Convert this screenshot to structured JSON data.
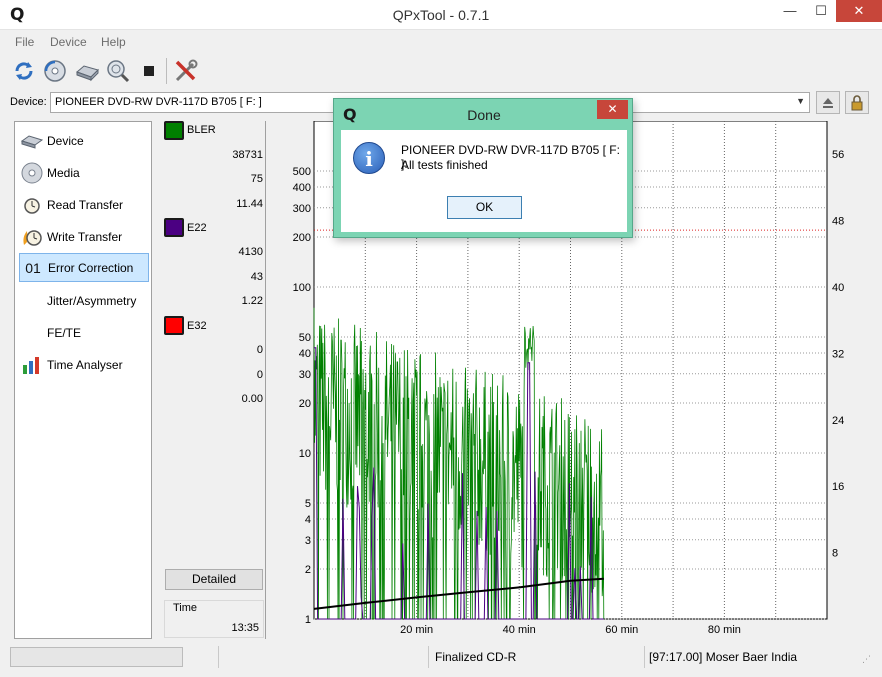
{
  "window": {
    "logo": "Q",
    "title": "QPxTool - 0.7.1",
    "minimize": "—",
    "maximize": "☐",
    "close": "✕"
  },
  "menu": [
    "File",
    "Device",
    "Help"
  ],
  "toolbar": {
    "icons": [
      "refresh-icon",
      "scan-media-icon",
      "drive-icon",
      "search-media-icon",
      "stop-icon",
      "tools-icon"
    ]
  },
  "device": {
    "label": "Device:",
    "selected": "PIONEER  DVD-RW  DVR-117D B705 [ F: ]"
  },
  "sidebar": {
    "items": [
      {
        "label": "Device",
        "icon": "device-icon"
      },
      {
        "label": "Media",
        "icon": "disc-icon"
      },
      {
        "label": "Read Transfer",
        "icon": "clock-icon"
      },
      {
        "label": "Write Transfer",
        "icon": "clock-flame-icon"
      },
      {
        "label": "Error Correction",
        "icon_text": "01",
        "active": true
      },
      {
        "label": "Jitter/Asymmetry"
      },
      {
        "label": "FE/TE"
      },
      {
        "label": "Time Analyser",
        "icon": "bar-chart-icon"
      }
    ]
  },
  "legend": {
    "bler": {
      "name": "BLER",
      "color": "#008000",
      "values": [
        "38731",
        "75",
        "11.44"
      ]
    },
    "e22": {
      "name": "E22",
      "color": "#4b0082",
      "values": [
        "4130",
        "43",
        "1.22"
      ]
    },
    "e32": {
      "name": "E32",
      "color": "#ff0000",
      "values": [
        "0",
        "0",
        "0.00"
      ]
    },
    "detailed_label": "Detailed",
    "time_label": "Time",
    "time_value": "13:35"
  },
  "chart_data": {
    "type": "line",
    "x_unit": "min",
    "xlim": [
      0,
      100
    ],
    "x_ticks": [
      20,
      40,
      60,
      80
    ],
    "x_tick_labels": [
      "20 min",
      "40 min",
      "60 min",
      "80 min"
    ],
    "y_left_scale": "log",
    "ylim_left": [
      1,
      1000
    ],
    "y_left_ticks": [
      1,
      2,
      3,
      4,
      5,
      10,
      20,
      30,
      40,
      50,
      100,
      200,
      300,
      400,
      500
    ],
    "y_right_ticks": [
      8,
      16,
      24,
      32,
      40,
      48,
      56
    ],
    "ylim_right": [
      0,
      60
    ],
    "threshold_line_left": 220,
    "grid": true,
    "series": [
      {
        "name": "BLER",
        "color": "#008000",
        "x_end": 56.5,
        "typical_start": 20,
        "typical_end": 5
      },
      {
        "name": "E22",
        "color": "#4b0082",
        "x_end": 56.5
      },
      {
        "name": "Speed",
        "color": "#000000",
        "x": [
          0,
          10,
          20,
          30,
          40,
          50,
          56.5
        ],
        "values": [
          1.15,
          1.25,
          1.35,
          1.45,
          1.55,
          1.7,
          1.75
        ]
      }
    ]
  },
  "status": {
    "disc_type": "Finalized CD-R",
    "media_info": "[97:17.00] Moser Baer India"
  },
  "dialog": {
    "logo": "Q",
    "title": "Done",
    "close": "✕",
    "icon": "info-icon",
    "icon_glyph": "i",
    "message_line1": "PIONEER  DVD-RW  DVR-117D B705 [ F: ]:",
    "message_line2": "All tests finished",
    "ok_label": "OK"
  }
}
